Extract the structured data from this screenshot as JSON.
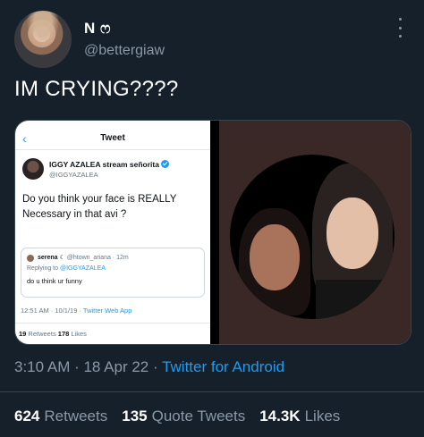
{
  "author": {
    "display_name": "N ෆ",
    "handle": "@bettergiaw"
  },
  "tweet": {
    "text": "IM CRYING????"
  },
  "media_screenshot": {
    "back_icon": "chevron-left-icon",
    "title": "Tweet",
    "name": "IGGY AZALEA stream señorita",
    "handle": "@IGGYAZALEA",
    "text": "Do you think your face is REALLY Necessary in that avi ?",
    "quote": {
      "name": "serena ☾",
      "meta": "@htown_ariana · 12m",
      "replying_prefix": "Replying to ",
      "replying_to": "@IGGYAZALEA",
      "text": "do u think ur funny"
    },
    "time": "12:51 AM · 10/1/19 · ",
    "via": "Twitter Web App",
    "retweets_count": "19",
    "retweets_label": " Retweets ",
    "likes_count": "178",
    "likes_label": " Likes"
  },
  "meta": {
    "time_date": "3:10 AM · 18 Apr 22 · ",
    "source": "Twitter for Android"
  },
  "stats": {
    "retweets_count": "624",
    "retweets_label": "Retweets",
    "quotes_count": "135",
    "quotes_label": "Quote Tweets",
    "likes_count": "14.3K",
    "likes_label": "Likes"
  },
  "colors": {
    "background": "#15202b",
    "accent": "#1d9bf0",
    "muted": "#8b98a5",
    "border": "#38444d"
  }
}
